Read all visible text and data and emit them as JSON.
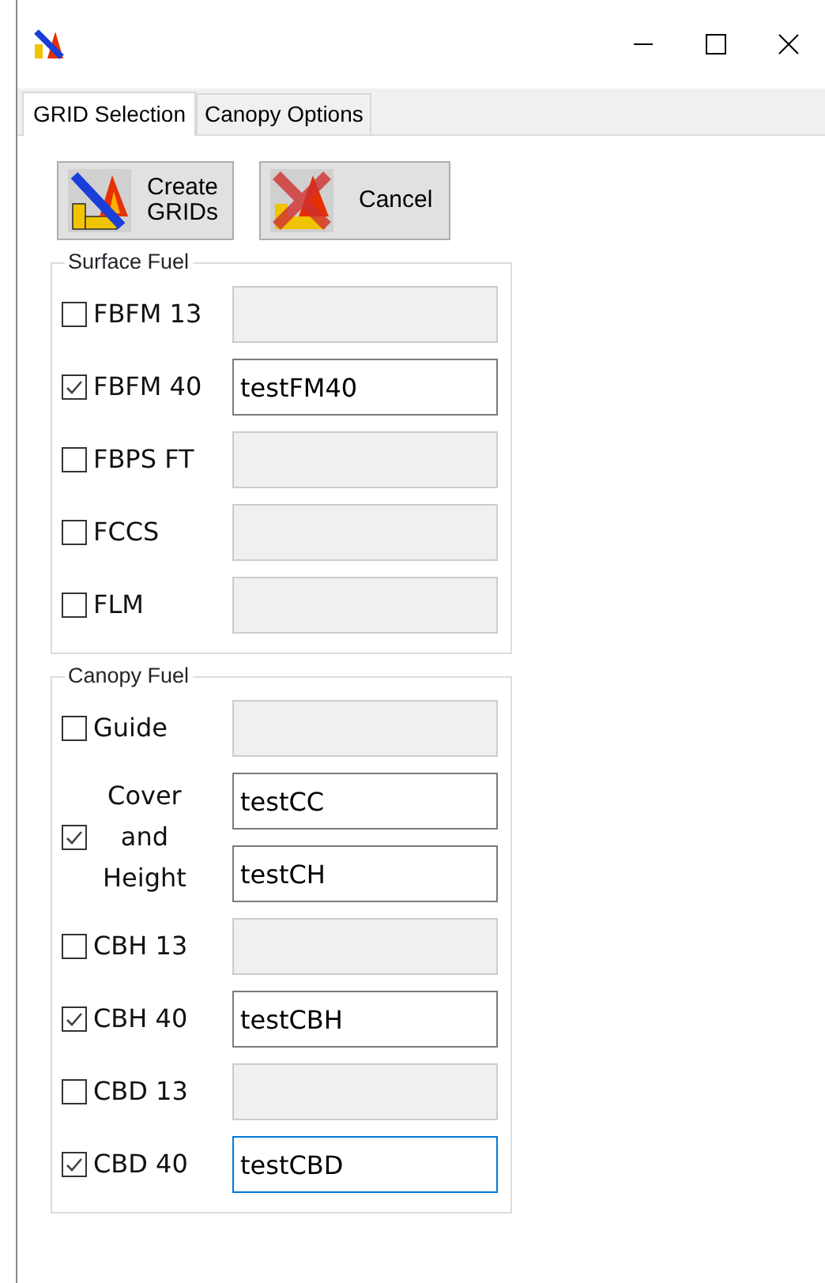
{
  "tabs": [
    {
      "label": "GRID Selection",
      "selected": true
    },
    {
      "label": "Canopy Options",
      "selected": false
    }
  ],
  "buttons": [
    {
      "kind": "create",
      "label": "Create GRIDs"
    },
    {
      "kind": "cancel",
      "label": "Cancel"
    }
  ],
  "groups": [
    {
      "title": "Surface Fuel",
      "rows": [
        {
          "label": "FBFM 13",
          "checked": false,
          "fields": [
            {
              "focused": false
            }
          ]
        },
        {
          "label": "FBFM 40",
          "checked": true,
          "fields": [
            {
              "value": "testFM40",
              "focused": false
            }
          ]
        },
        {
          "label": "FBPS FT",
          "checked": false,
          "fields": [
            {
              "focused": false
            }
          ]
        },
        {
          "label": "FCCS",
          "checked": false,
          "fields": [
            {
              "focused": false
            }
          ]
        },
        {
          "label": "FLM",
          "checked": false,
          "fields": [
            {
              "focused": false
            }
          ]
        }
      ]
    },
    {
      "title": "Canopy Fuel",
      "rows": [
        {
          "label": "Guide",
          "checked": false,
          "fields": [
            {
              "focused": false
            }
          ]
        },
        {
          "label": "Cover and Height",
          "checked": true,
          "fields": [
            {
              "value": "testCC",
              "focused": false
            },
            {
              "value": "testCH",
              "focused": false
            }
          ]
        },
        {
          "label": "CBH 13",
          "checked": false,
          "fields": [
            {
              "focused": false
            }
          ]
        },
        {
          "label": "CBH 40",
          "checked": true,
          "fields": [
            {
              "value": "testCBH",
              "focused": false
            }
          ]
        },
        {
          "label": "CBD 13",
          "checked": false,
          "fields": [
            {
              "focused": false
            }
          ]
        },
        {
          "label": "CBD 40",
          "checked": true,
          "fields": [
            {
              "value": "testCBD",
              "focused": true
            }
          ]
        }
      ]
    }
  ]
}
